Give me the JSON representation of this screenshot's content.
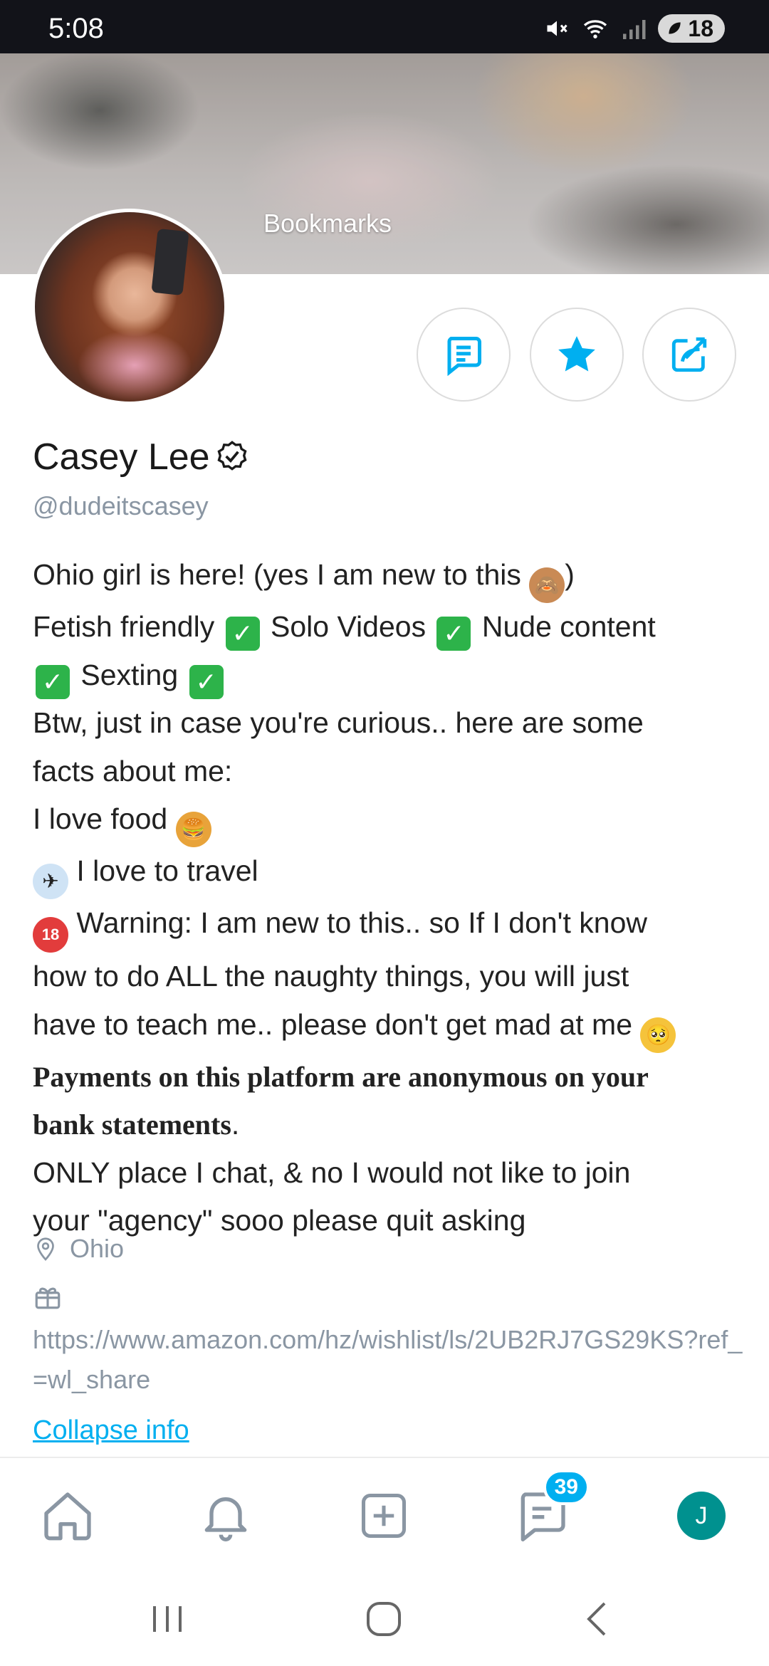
{
  "status_bar": {
    "time": "5:08",
    "battery": "18"
  },
  "cover": {
    "title": "Bookmarks"
  },
  "profile": {
    "name": "Casey Lee",
    "handle": "@dudeitscasey"
  },
  "bio": {
    "l1_a": "Ohio girl is here! (yes I am new to this ",
    "l1_b": ")",
    "l2_a": "Fetish friendly ",
    "l2_b": " Solo Videos ",
    "l2_c": " Nude content",
    "l3_a": " Sexting ",
    "l4": "Btw, just in case you're curious.. here are some",
    "l5": "facts about me:",
    "l6": "I love food ",
    "l7": " I love to travel",
    "l8": " Warning: I am new to this.. so If I don't know",
    "l9": "how to do ALL the naughty things, you will just",
    "l10": "have to teach me.. please don't get mad at me ",
    "l11": "Payments on this platform are anonymous on your",
    "l12_a": "bank statements",
    "l12_b": ".",
    "l13": "ONLY place I chat, & no I would not like to join",
    "l14": "your \"agency\" sooo please quit asking"
  },
  "location": "Ohio",
  "wishlist_url": "https://www.amazon.com/hz/wishlist/ls/2UB2RJ7GS29KS?ref_=wl_share",
  "collapse_label": "Collapse info",
  "nav": {
    "messages_badge": "39",
    "avatar_initial": "J"
  },
  "colors": {
    "accent": "#00aff0",
    "avatar_bg": "#00918f",
    "check_green": "#2db34a"
  }
}
